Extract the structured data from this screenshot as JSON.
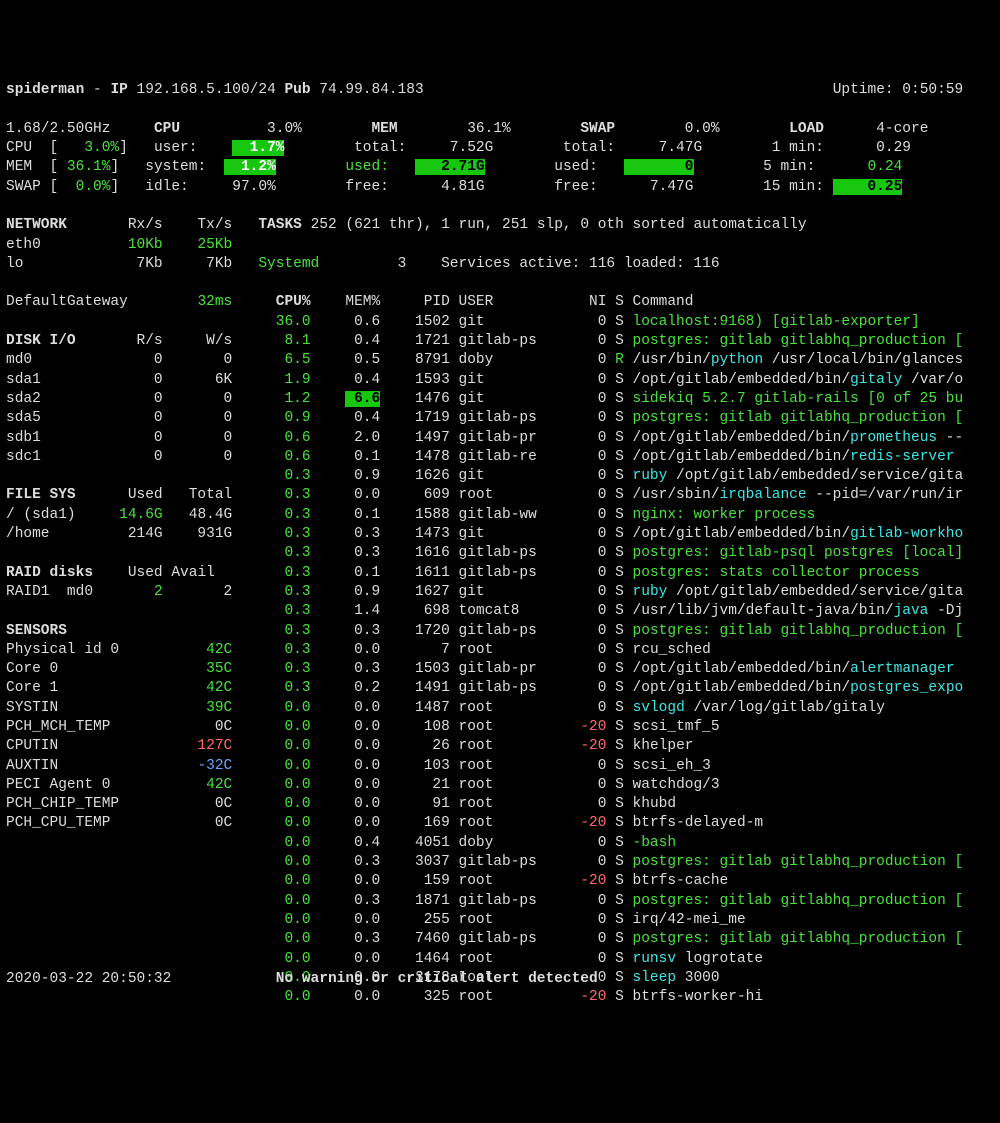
{
  "header": {
    "hostname": "spiderman",
    "ip_label": "IP",
    "ip": "192.168.5.100/24",
    "pub_label": "Pub",
    "pub": "74.99.84.183",
    "uptime_label": "Uptime:",
    "uptime": "0:50:59"
  },
  "cpu_block": {
    "freq": "1.68/2.50GHz",
    "cpu_label": "CPU",
    "cpu_pct": "3.0%",
    "user_label": "user:",
    "user_val": "1.7%",
    "system_label": "system:",
    "system_val": "1.2%",
    "idle_label": "idle:",
    "idle_val": "97.0%",
    "cpu_bar": "CPU  [  3.0%] ",
    "mem_bar": "MEM  [ 36.1%] ",
    "swap_bar": "SWAP [  0.0%] "
  },
  "mem_block": {
    "label": "MEM",
    "pct": "36.1%",
    "total_l": "total:",
    "total_v": "7.52G",
    "used_l": "used:",
    "used_v": "2.71G",
    "free_l": "free:",
    "free_v": "4.81G"
  },
  "swap_block": {
    "label": "SWAP",
    "pct": "0.0%",
    "total_l": "total:",
    "total_v": "7.47G",
    "used_l": "used:",
    "used_v": "0",
    "free_l": "free:",
    "free_v": "7.47G"
  },
  "load_block": {
    "label": "LOAD",
    "core": "4-core",
    "m1_l": "1 min:",
    "m1_v": "0.29",
    "m5_l": "5 min:",
    "m5_v": "0.24",
    "m15_l": "15 min:",
    "m15_v": "0.25"
  },
  "network": {
    "label": "NETWORK",
    "rx": "Rx/s",
    "tx": "Tx/s",
    "rows": [
      {
        "if": "eth0",
        "rx": "10Kb",
        "tx": "25Kb",
        "hl": true
      },
      {
        "if": "lo",
        "rx": "7Kb",
        "tx": "7Kb",
        "hl": false
      }
    ]
  },
  "tasks": {
    "label": "TASKS",
    "text": "252 (621 thr), 1 run, 251 slp, 0 oth sorted automatically"
  },
  "systemd": {
    "label": "Systemd",
    "num": "3",
    "text": "Services active: 116 loaded: 116"
  },
  "gateway": {
    "label": "DefaultGateway",
    "val": "32ms"
  },
  "proc_header": {
    "cpu": "CPU%",
    "mem": "MEM%",
    "pid": "PID",
    "user": "USER",
    "ni": "NI",
    "s": "S",
    "cmd": "Command"
  },
  "processes": [
    {
      "cpu": "36.0",
      "mem": "0.6",
      "pid": "1502",
      "user": "git",
      "ni": "0",
      "s": "S",
      "cmd": [
        [
          "gr",
          "localhost:9168) [gitlab-exporter]"
        ]
      ]
    },
    {
      "cpu": "8.1",
      "mem": "0.4",
      "pid": "1721",
      "user": "gitlab-ps",
      "ni": "0",
      "s": "S",
      "cmd": [
        [
          "gr",
          "postgres: gitlab gitlabhq_production ["
        ]
      ]
    },
    {
      "cpu": "6.5",
      "mem": "0.5",
      "pid": "8791",
      "user": "doby",
      "ni": "0",
      "s": "R",
      "r": true,
      "cmd": [
        [
          "",
          "/usr/bin/"
        ],
        [
          "cy",
          "python"
        ],
        [
          "",
          " /usr/local/bin/glances"
        ]
      ]
    },
    {
      "cpu": "1.9",
      "mem": "0.4",
      "pid": "1593",
      "user": "git",
      "ni": "0",
      "s": "S",
      "cmd": [
        [
          "",
          "/opt/gitlab/embedded/bin/"
        ],
        [
          "cy",
          "gitaly"
        ],
        [
          "",
          " /var/o"
        ]
      ]
    },
    {
      "cpu": "1.2",
      "mem": "6.6",
      "pid": "1476",
      "user": "git",
      "ni": "0",
      "s": "S",
      "memhl": true,
      "cmd": [
        [
          "gr",
          "sidekiq 5.2.7 gitlab-rails [0 of 25 bu"
        ]
      ]
    },
    {
      "cpu": "0.9",
      "mem": "0.4",
      "pid": "1719",
      "user": "gitlab-ps",
      "ni": "0",
      "s": "S",
      "cmd": [
        [
          "gr",
          "postgres: gitlab gitlabhq_production ["
        ]
      ]
    },
    {
      "cpu": "0.6",
      "mem": "2.0",
      "pid": "1497",
      "user": "gitlab-pr",
      "ni": "0",
      "s": "S",
      "cmd": [
        [
          "",
          "/opt/gitlab/embedded/bin/"
        ],
        [
          "cy",
          "prometheus"
        ],
        [
          "",
          " --"
        ]
      ]
    },
    {
      "cpu": "0.6",
      "mem": "0.1",
      "pid": "1478",
      "user": "gitlab-re",
      "ni": "0",
      "s": "S",
      "cmd": [
        [
          "",
          "/opt/gitlab/embedded/bin/"
        ],
        [
          "cy",
          "redis-server"
        ]
      ]
    },
    {
      "cpu": "0.3",
      "mem": "0.9",
      "pid": "1626",
      "user": "git",
      "ni": "0",
      "s": "S",
      "cmd": [
        [
          "cy",
          "ruby"
        ],
        [
          "",
          " /opt/gitlab/embedded/service/gita"
        ]
      ]
    },
    {
      "cpu": "0.3",
      "mem": "0.0",
      "pid": "609",
      "user": "root",
      "ni": "0",
      "s": "S",
      "cmd": [
        [
          "",
          "/usr/sbin/"
        ],
        [
          "cy",
          "irqbalance"
        ],
        [
          "",
          " --pid=/var/run/ir"
        ]
      ]
    },
    {
      "cpu": "0.3",
      "mem": "0.1",
      "pid": "1588",
      "user": "gitlab-ww",
      "ni": "0",
      "s": "S",
      "cmd": [
        [
          "gr",
          "nginx: worker process"
        ]
      ]
    },
    {
      "cpu": "0.3",
      "mem": "0.3",
      "pid": "1473",
      "user": "git",
      "ni": "0",
      "s": "S",
      "cmd": [
        [
          "",
          "/opt/gitlab/embedded/bin/"
        ],
        [
          "cy",
          "gitlab-workho"
        ]
      ]
    },
    {
      "cpu": "0.3",
      "mem": "0.3",
      "pid": "1616",
      "user": "gitlab-ps",
      "ni": "0",
      "s": "S",
      "cmd": [
        [
          "gr",
          "postgres: gitlab-psql postgres [local]"
        ]
      ]
    },
    {
      "cpu": "0.3",
      "mem": "0.1",
      "pid": "1611",
      "user": "gitlab-ps",
      "ni": "0",
      "s": "S",
      "cmd": [
        [
          "gr",
          "postgres: stats collector process"
        ]
      ]
    },
    {
      "cpu": "0.3",
      "mem": "0.9",
      "pid": "1627",
      "user": "git",
      "ni": "0",
      "s": "S",
      "cmd": [
        [
          "cy",
          "ruby"
        ],
        [
          "",
          " /opt/gitlab/embedded/service/gita"
        ]
      ]
    },
    {
      "cpu": "0.3",
      "mem": "1.4",
      "pid": "698",
      "user": "tomcat8",
      "ni": "0",
      "s": "S",
      "cmd": [
        [
          "",
          "/usr/lib/jvm/default-java/bin/"
        ],
        [
          "cy",
          "java"
        ],
        [
          "",
          " -Dj"
        ]
      ]
    },
    {
      "cpu": "0.3",
      "mem": "0.3",
      "pid": "1720",
      "user": "gitlab-ps",
      "ni": "0",
      "s": "S",
      "cmd": [
        [
          "gr",
          "postgres: gitlab gitlabhq_production ["
        ]
      ]
    },
    {
      "cpu": "0.3",
      "mem": "0.0",
      "pid": "7",
      "user": "root",
      "ni": "0",
      "s": "S",
      "cmd": [
        [
          "",
          "rcu_sched"
        ]
      ]
    },
    {
      "cpu": "0.3",
      "mem": "0.3",
      "pid": "1503",
      "user": "gitlab-pr",
      "ni": "0",
      "s": "S",
      "cmd": [
        [
          "",
          "/opt/gitlab/embedded/bin/"
        ],
        [
          "cy",
          "alertmanager"
        ]
      ]
    },
    {
      "cpu": "0.3",
      "mem": "0.2",
      "pid": "1491",
      "user": "gitlab-ps",
      "ni": "0",
      "s": "S",
      "cmd": [
        [
          "",
          "/opt/gitlab/embedded/bin/"
        ],
        [
          "cy",
          "postgres_expo"
        ]
      ]
    },
    {
      "cpu": "0.0",
      "mem": "0.0",
      "pid": "1487",
      "user": "root",
      "ni": "0",
      "s": "S",
      "cmd": [
        [
          "cy",
          "svlogd"
        ],
        [
          "",
          " /var/log/gitlab/gitaly"
        ]
      ]
    },
    {
      "cpu": "0.0",
      "mem": "0.0",
      "pid": "108",
      "user": "root",
      "ni": "-20",
      "s": "S",
      "nihl": true,
      "cmd": [
        [
          "",
          "scsi_tmf_5"
        ]
      ]
    },
    {
      "cpu": "0.0",
      "mem": "0.0",
      "pid": "26",
      "user": "root",
      "ni": "-20",
      "s": "S",
      "nihl": true,
      "cmd": [
        [
          "",
          "khelper"
        ]
      ]
    },
    {
      "cpu": "0.0",
      "mem": "0.0",
      "pid": "103",
      "user": "root",
      "ni": "0",
      "s": "S",
      "cmd": [
        [
          "",
          "scsi_eh_3"
        ]
      ]
    },
    {
      "cpu": "0.0",
      "mem": "0.0",
      "pid": "21",
      "user": "root",
      "ni": "0",
      "s": "S",
      "cmd": [
        [
          "",
          "watchdog/3"
        ]
      ]
    },
    {
      "cpu": "0.0",
      "mem": "0.0",
      "pid": "91",
      "user": "root",
      "ni": "0",
      "s": "S",
      "cmd": [
        [
          "",
          "khubd"
        ]
      ]
    },
    {
      "cpu": "0.0",
      "mem": "0.0",
      "pid": "169",
      "user": "root",
      "ni": "-20",
      "s": "S",
      "nihl": true,
      "cmd": [
        [
          "",
          "btrfs-delayed-m"
        ]
      ]
    },
    {
      "cpu": "0.0",
      "mem": "0.4",
      "pid": "4051",
      "user": "doby",
      "ni": "0",
      "s": "S",
      "cmd": [
        [
          "gr",
          "-bash"
        ]
      ]
    },
    {
      "cpu": "0.0",
      "mem": "0.3",
      "pid": "3037",
      "user": "gitlab-ps",
      "ni": "0",
      "s": "S",
      "cmd": [
        [
          "gr",
          "postgres: gitlab gitlabhq_production ["
        ]
      ]
    },
    {
      "cpu": "0.0",
      "mem": "0.0",
      "pid": "159",
      "user": "root",
      "ni": "-20",
      "s": "S",
      "nihl": true,
      "cmd": [
        [
          "",
          "btrfs-cache"
        ]
      ]
    },
    {
      "cpu": "0.0",
      "mem": "0.3",
      "pid": "1871",
      "user": "gitlab-ps",
      "ni": "0",
      "s": "S",
      "cmd": [
        [
          "gr",
          "postgres: gitlab gitlabhq_production ["
        ]
      ]
    },
    {
      "cpu": "0.0",
      "mem": "0.0",
      "pid": "255",
      "user": "root",
      "ni": "0",
      "s": "S",
      "cmd": [
        [
          "",
          "irq/42-mei_me"
        ]
      ]
    },
    {
      "cpu": "0.0",
      "mem": "0.3",
      "pid": "7460",
      "user": "gitlab-ps",
      "ni": "0",
      "s": "S",
      "cmd": [
        [
          "gr",
          "postgres: gitlab gitlabhq_production ["
        ]
      ]
    },
    {
      "cpu": "0.0",
      "mem": "0.0",
      "pid": "1464",
      "user": "root",
      "ni": "0",
      "s": "S",
      "cmd": [
        [
          "cy",
          "runsv"
        ],
        [
          "",
          " logrotate"
        ]
      ]
    },
    {
      "cpu": "0.0",
      "mem": "0.0",
      "pid": "3178",
      "user": "root",
      "ni": "0",
      "s": "S",
      "cmd": [
        [
          "cy",
          "sleep"
        ],
        [
          "",
          " 3000"
        ]
      ]
    },
    {
      "cpu": "0.0",
      "mem": "0.0",
      "pid": "325",
      "user": "root",
      "ni": "-20",
      "s": "S",
      "nihl": true,
      "cmd": [
        [
          "",
          "btrfs-worker-hi"
        ]
      ]
    }
  ],
  "diskio": {
    "label": "DISK I/O",
    "r": "R/s",
    "w": "W/s",
    "rows": [
      {
        "d": "md0",
        "r": "0",
        "w": "0"
      },
      {
        "d": "sda1",
        "r": "0",
        "w": "6K"
      },
      {
        "d": "sda2",
        "r": "0",
        "w": "0"
      },
      {
        "d": "sda5",
        "r": "0",
        "w": "0"
      },
      {
        "d": "sdb1",
        "r": "0",
        "w": "0"
      },
      {
        "d": "sdc1",
        "r": "0",
        "w": "0"
      }
    ]
  },
  "filesys": {
    "label": "FILE SYS",
    "u": "Used",
    "t": "Total",
    "rows": [
      {
        "d": "/ (sda1)",
        "u": "14.6G",
        "t": "48.4G",
        "hl": true
      },
      {
        "d": "/home",
        "u": "214G",
        "t": "931G",
        "hl": false
      }
    ]
  },
  "raid": {
    "label": "RAID disks",
    "u": "Used",
    "a": "Avail",
    "rows": [
      {
        "d": "RAID1  md0",
        "u": "2",
        "a": "2"
      }
    ]
  },
  "sensors": {
    "label": "SENSORS",
    "rows": [
      {
        "n": "Physical id 0",
        "v": "42C",
        "c": "gr"
      },
      {
        "n": "Core 0",
        "v": "35C",
        "c": "gr"
      },
      {
        "n": "Core 1",
        "v": "42C",
        "c": "gr"
      },
      {
        "n": "SYSTIN",
        "v": "39C",
        "c": "gr"
      },
      {
        "n": "PCH_MCH_TEMP",
        "v": "0C",
        "c": ""
      },
      {
        "n": "CPUTIN",
        "v": "127C",
        "c": "red"
      },
      {
        "n": "AUXTIN",
        "v": "-32C",
        "c": "bl"
      },
      {
        "n": "PECI Agent 0",
        "v": "42C",
        "c": "gr"
      },
      {
        "n": "PCH_CHIP_TEMP",
        "v": "0C",
        "c": ""
      },
      {
        "n": "PCH_CPU_TEMP",
        "v": "0C",
        "c": ""
      }
    ]
  },
  "footer": {
    "time": "2020-03-22 20:50:32",
    "msg": "No warning or critical alert detected"
  }
}
